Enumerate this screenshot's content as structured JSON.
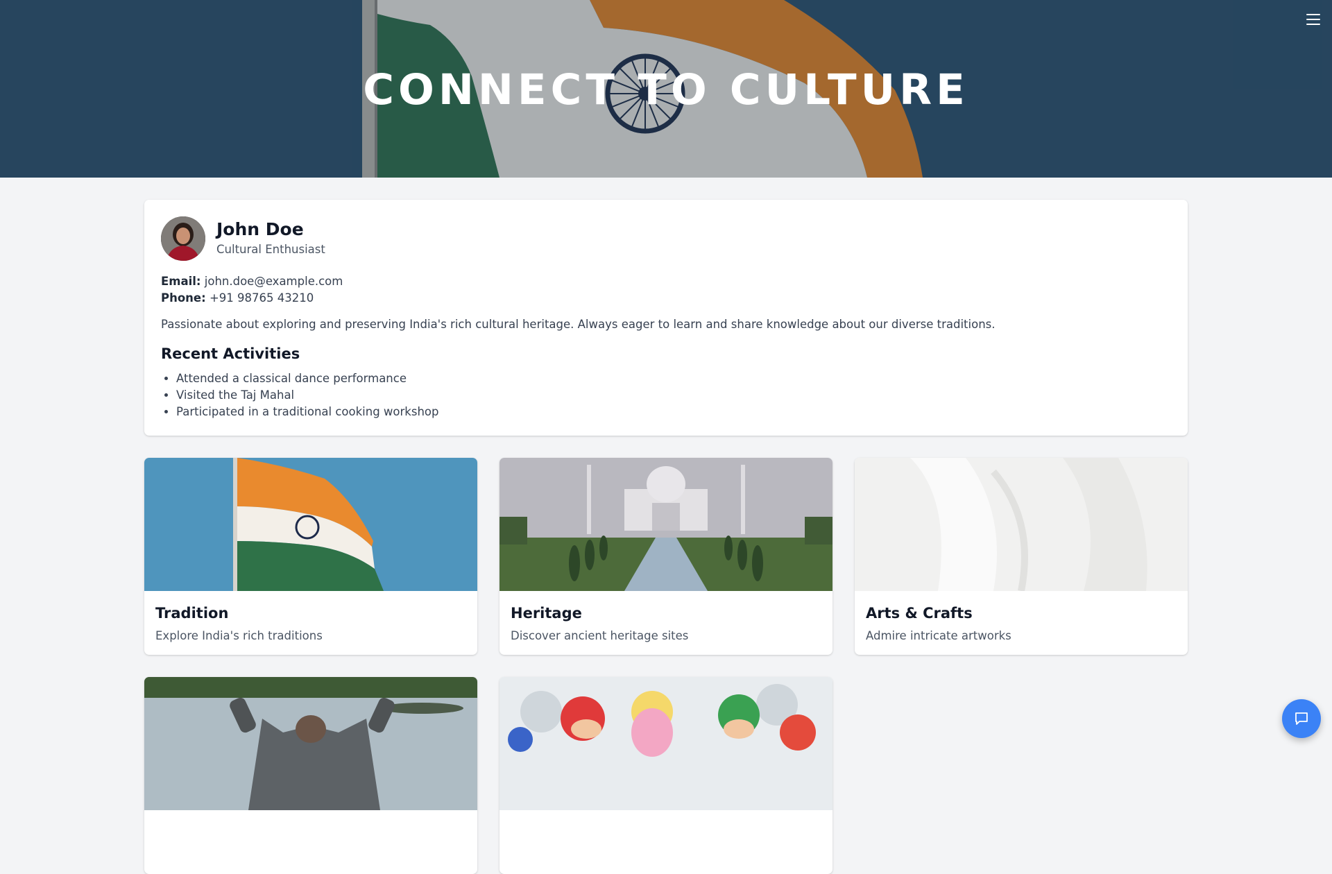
{
  "hero": {
    "title": "CONNECT TO CULTURE",
    "menu_icon": "hamburger-menu-icon"
  },
  "profile": {
    "name": "John Doe",
    "role": "Cultural Enthusiast",
    "email_label": "Email:",
    "email": "john.doe@example.com",
    "phone_label": "Phone:",
    "phone": "+91 98765 43210",
    "bio": "Passionate about exploring and preserving India's rich cultural heritage. Always eager to learn and share knowledge about our diverse traditions.",
    "activities_title": "Recent Activities",
    "activities": [
      "Attended a classical dance performance",
      "Visited the Taj Mahal",
      "Participated in a traditional cooking workshop"
    ]
  },
  "cards": [
    {
      "title": "Tradition",
      "description": "Explore India's rich traditions"
    },
    {
      "title": "Heritage",
      "description": "Discover ancient heritage sites"
    },
    {
      "title": "Arts & Crafts",
      "description": "Admire intricate artworks"
    }
  ],
  "chat": {
    "icon": "chat-bubble-icon"
  },
  "colors": {
    "accent": "#3b82f6",
    "page_background": "#f3f4f6",
    "hero_overlay": "#27475f"
  }
}
